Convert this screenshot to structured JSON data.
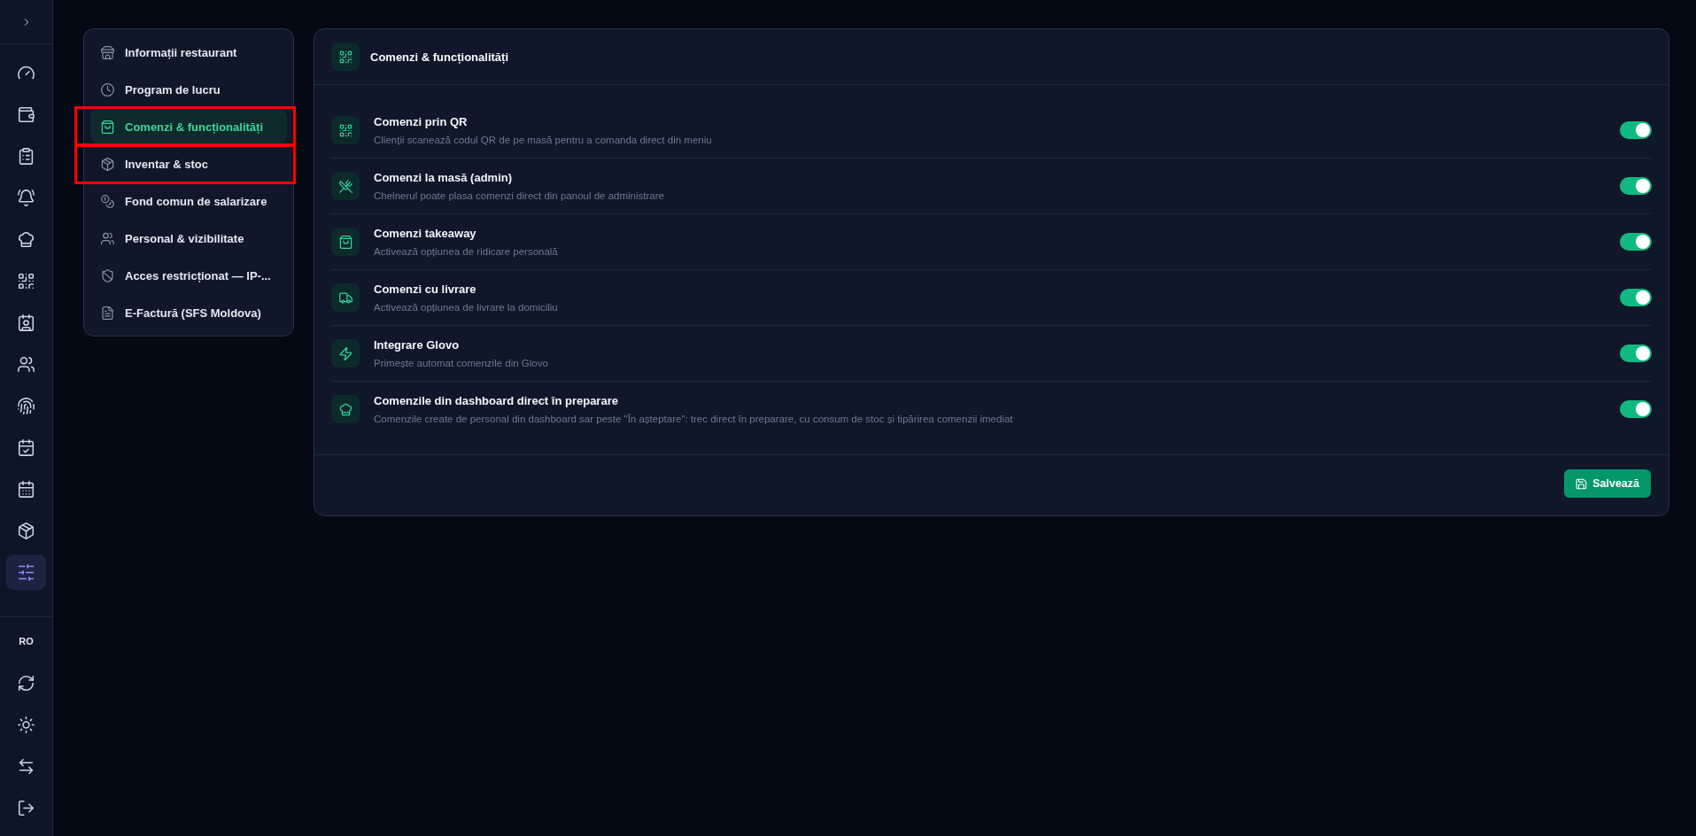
{
  "rail": {
    "items": [
      {
        "selected": false
      },
      {
        "selected": false
      },
      {
        "selected": false
      },
      {
        "selected": false
      },
      {
        "selected": false
      },
      {
        "selected": false
      },
      {
        "selected": false
      },
      {
        "selected": false
      },
      {
        "selected": false
      },
      {
        "selected": false
      },
      {
        "selected": false
      },
      {
        "selected": false
      },
      {
        "selected": true
      }
    ],
    "language": "RO"
  },
  "settings_nav": {
    "items": [
      {
        "label": "Informații restaurant",
        "selected": false,
        "highlighted": false
      },
      {
        "label": "Program de lucru",
        "selected": false,
        "highlighted": false
      },
      {
        "label": "Comenzi & funcționalități",
        "selected": true,
        "highlighted": true
      },
      {
        "label": "Inventar & stoc",
        "selected": false,
        "highlighted": true
      },
      {
        "label": "Fond comun de salarizare",
        "selected": false,
        "highlighted": false
      },
      {
        "label": "Personal & vizibilitate",
        "selected": false,
        "highlighted": false
      },
      {
        "label": "Acces restricționat — IP-...",
        "selected": false,
        "highlighted": false
      },
      {
        "label": "E-Factură (SFS Moldova)",
        "selected": false,
        "highlighted": false
      }
    ]
  },
  "panel": {
    "title": "Comenzi & funcționalități",
    "features": [
      {
        "title": "Comenzi prin QR",
        "description": "Clienții scanează codul QR de pe masă pentru a comanda direct din meniu",
        "on": true
      },
      {
        "title": "Comenzi la masă (admin)",
        "description": "Chelnerul poate plasa comenzi direct din panoul de administrare",
        "on": true
      },
      {
        "title": "Comenzi takeaway",
        "description": "Activează opțiunea de ridicare personală",
        "on": true
      },
      {
        "title": "Comenzi cu livrare",
        "description": "Activează opțiunea de livrare la domiciliu",
        "on": true
      },
      {
        "title": "Integrare Glovo",
        "description": "Primește automat comenzile din Glovo",
        "on": true
      },
      {
        "title": "Comenzile din dashboard direct în preparare",
        "description": "Comenzile create de personal din dashboard sar peste \"În așteptare\": trec direct în preparare, cu consum de stoc și tipărirea comenzii imediat",
        "on": true
      }
    ],
    "save_button": "Salvează"
  }
}
